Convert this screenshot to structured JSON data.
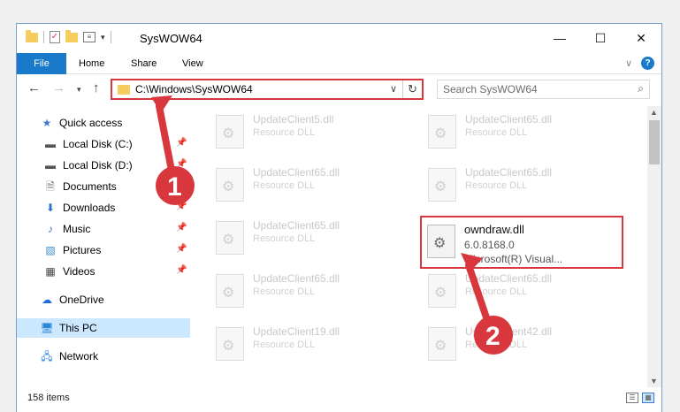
{
  "window": {
    "title": "SysWOW64",
    "minimize_icon": "minimize-icon",
    "maximize_icon": "maximize-icon",
    "close_icon": "close-icon"
  },
  "ribbon": {
    "tabs": [
      "File",
      "Home",
      "Share",
      "View"
    ]
  },
  "address": {
    "path": "C:\\Windows\\SysWOW64",
    "search_placeholder": "Search SysWOW64"
  },
  "nav": {
    "items": [
      {
        "label": "Quick access",
        "icon": "star-icon",
        "pinned": false
      },
      {
        "label": "Local Disk (C:)",
        "icon": "drive-icon",
        "pinned": true
      },
      {
        "label": "Local Disk (D:)",
        "icon": "drive-icon",
        "pinned": true
      },
      {
        "label": "Documents",
        "icon": "documents-icon",
        "pinned": true
      },
      {
        "label": "Downloads",
        "icon": "download-icon",
        "pinned": true
      },
      {
        "label": "Music",
        "icon": "music-icon",
        "pinned": true
      },
      {
        "label": "Pictures",
        "icon": "pictures-icon",
        "pinned": true
      },
      {
        "label": "Videos",
        "icon": "videos-icon",
        "pinned": true
      },
      {
        "label": "OneDrive",
        "icon": "cloud-icon",
        "pinned": false
      },
      {
        "label": "This PC",
        "icon": "computer-icon",
        "pinned": false
      },
      {
        "label": "Network",
        "icon": "network-icon",
        "pinned": false
      }
    ]
  },
  "files": [
    {
      "name": "UpdateClient5.dll",
      "type": "Resource DLL"
    },
    {
      "name": "UpdateClient65.dll",
      "type": "Resource DLL"
    },
    {
      "name": "UpdateClient65.dll",
      "type": "Resource DLL"
    },
    {
      "name": "UpdateClient65.dll",
      "type": "Resource DLL"
    },
    {
      "name": "UpdateClient65.dll",
      "type": "Resource DLL"
    },
    {
      "name": "UpdateClient65.dll",
      "type": "Resource DLL"
    },
    {
      "name": "UpdateClient65.dll",
      "type": "Resource DLL"
    },
    {
      "name": "UpdateClient19.dll",
      "type": "Resource DLL"
    },
    {
      "name": "UpdateClient42.dll",
      "type": "Resource DLL"
    }
  ],
  "highlighted_file": {
    "name": "owndraw.dll",
    "version": "6.0.8168.0",
    "company": "Microsoft(R) Visual..."
  },
  "status": {
    "items_count": "158 items"
  },
  "annotations": {
    "step1": "1",
    "step2": "2",
    "color": "#d9373e"
  }
}
